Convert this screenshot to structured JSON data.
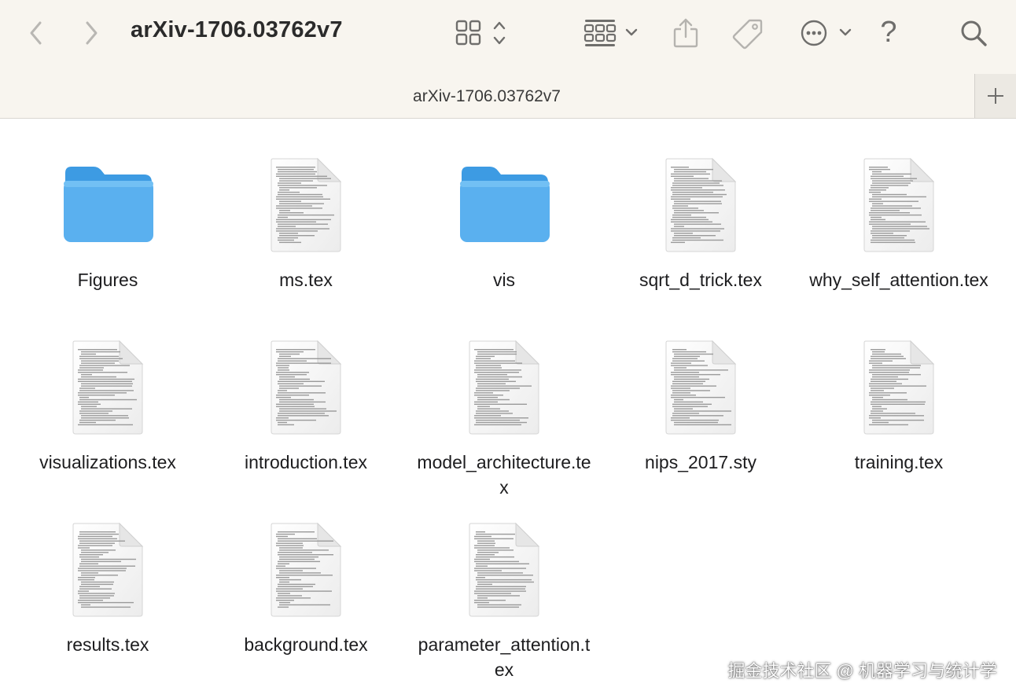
{
  "window": {
    "title": "arXiv-1706.03762v7",
    "tab_title": "arXiv-1706.03762v7"
  },
  "toolbar": {
    "back": "chevron-left-icon",
    "forward": "chevron-right-icon",
    "view_icon": "grid-view-icon",
    "group_icon": "group-by-icon",
    "share": "share-icon",
    "tag": "tag-icon",
    "more": "ellipsis-icon",
    "help_label": "?",
    "search": "search-icon",
    "new_tab": "plus-icon"
  },
  "colors": {
    "toolbar_bg": "#f8f5ef",
    "folder_blue": "#5ab0ef",
    "folder_blue_dark": "#3d9be3",
    "text": "#1d1d1f"
  },
  "files": [
    {
      "name": "Figures",
      "kind": "folder"
    },
    {
      "name": "ms.tex",
      "kind": "document"
    },
    {
      "name": "vis",
      "kind": "folder"
    },
    {
      "name": "sqrt_d_trick.tex",
      "kind": "document"
    },
    {
      "name": "why_self_attention.tex",
      "kind": "document"
    },
    {
      "name": "visualizations.tex",
      "kind": "document"
    },
    {
      "name": "introduction.tex",
      "kind": "document"
    },
    {
      "name": "model_architecture.tex",
      "kind": "document"
    },
    {
      "name": "nips_2017.sty",
      "kind": "document"
    },
    {
      "name": "training.tex",
      "kind": "document"
    },
    {
      "name": "results.tex",
      "kind": "document"
    },
    {
      "name": "background.tex",
      "kind": "document"
    },
    {
      "name": "parameter_attention.tex",
      "kind": "document"
    }
  ],
  "watermark": "掘金技术社区 @ 机器学习与统计学"
}
